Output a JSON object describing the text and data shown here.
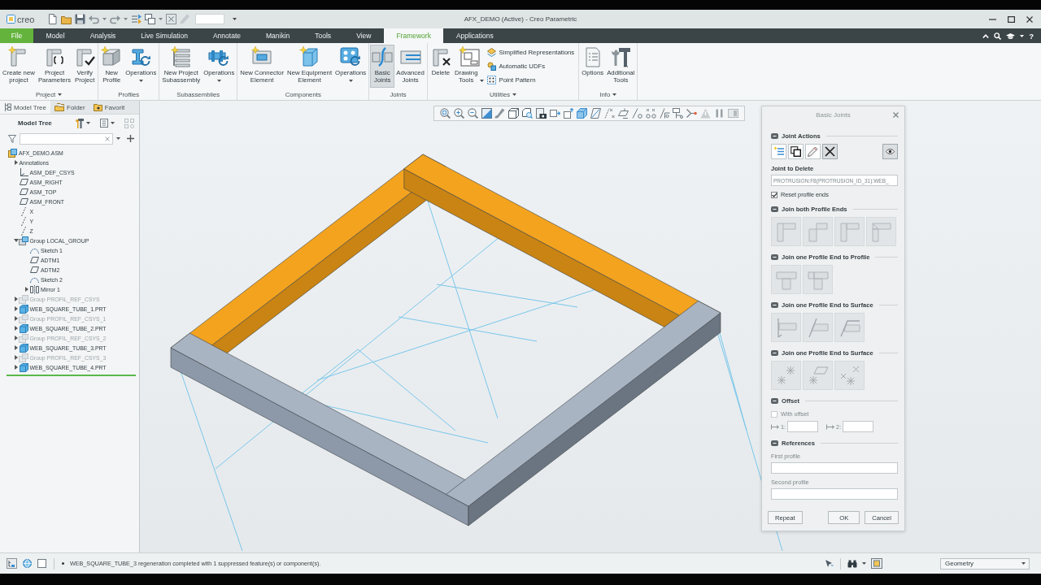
{
  "title_bar": {
    "logo": "creo",
    "title": "AFX_DEMO (Active) - Creo Parametric"
  },
  "tabs": [
    {
      "label": "File",
      "kind": "menu",
      "selected": false
    },
    {
      "label": "Model",
      "kind": "tab",
      "selected": false
    },
    {
      "label": "Analysis",
      "kind": "tab",
      "selected": false
    },
    {
      "label": "Live Simulation",
      "kind": "tab",
      "selected": false
    },
    {
      "label": "Annotate",
      "kind": "tab",
      "selected": false
    },
    {
      "label": "Manikin",
      "kind": "tab",
      "selected": false
    },
    {
      "label": "Tools",
      "kind": "tab",
      "selected": false
    },
    {
      "label": "View",
      "kind": "tab",
      "selected": false
    },
    {
      "label": "Framework",
      "kind": "tab",
      "selected": true
    },
    {
      "label": "Applications",
      "kind": "tab",
      "selected": false
    }
  ],
  "help": "?",
  "ribbon": {
    "groups": [
      {
        "label": "Project",
        "has_menu": true,
        "buttons": [
          {
            "label": "Create new\nproject",
            "has_menu": false,
            "selected": false
          },
          {
            "label": "Project\nParameters",
            "has_menu": false,
            "selected": false
          },
          {
            "label": "Verify\nProject",
            "has_menu": false,
            "selected": false
          }
        ]
      },
      {
        "label": "Profiles",
        "has_menu": false,
        "buttons": [
          {
            "label": "New\nProfile",
            "has_menu": false,
            "selected": false
          },
          {
            "label": "Operations",
            "has_menu": true,
            "selected": false
          }
        ]
      },
      {
        "label": "Subassemblies",
        "has_menu": false,
        "buttons": [
          {
            "label": "New Project\nSubassembly",
            "has_menu": false,
            "selected": false
          },
          {
            "label": "Operations",
            "has_menu": true,
            "selected": false
          }
        ]
      },
      {
        "label": "Components",
        "has_menu": false,
        "buttons": [
          {
            "label": "New Connector\nElement",
            "has_menu": false,
            "selected": false
          },
          {
            "label": "New Equipment\nElement",
            "has_menu": false,
            "selected": false
          },
          {
            "label": "Operations",
            "has_menu": true,
            "selected": false
          }
        ]
      },
      {
        "label": "Joints",
        "has_menu": false,
        "buttons": [
          {
            "label": "Basic\nJoints",
            "has_menu": false,
            "selected": true
          },
          {
            "label": "Advanced\nJoints",
            "has_menu": false,
            "selected": false
          }
        ]
      },
      {
        "label": "Utilities",
        "has_menu": true,
        "buttons": [
          {
            "label": "Delete",
            "has_menu": false,
            "selected": false
          },
          {
            "label": "Drawing\nTools",
            "has_menu": true,
            "selected": false
          }
        ],
        "small_buttons": [
          {
            "label": "Simplified Representations"
          },
          {
            "label": "Automatic UDFs"
          },
          {
            "label": "Point Pattern"
          }
        ]
      },
      {
        "label": "Info",
        "has_menu": true,
        "buttons": [
          {
            "label": "Options",
            "has_menu": false,
            "selected": false
          },
          {
            "label": "Additional\nTools",
            "has_menu": false,
            "selected": false
          }
        ]
      }
    ]
  },
  "model_tree": {
    "tabs": [
      {
        "label": "Model Tree",
        "selected": true
      },
      {
        "label": "Folder",
        "selected": false
      },
      {
        "label": "Favorit",
        "selected": false
      }
    ],
    "title": "Model Tree",
    "items": [
      {
        "label": "AFX_DEMO.ASM",
        "kind": "assembly",
        "suppressed": false,
        "children": [
          {
            "label": "Annotations",
            "kind": "annotations",
            "expanded": false,
            "suppressed": false
          },
          {
            "label": "ASM_DEF_CSYS",
            "kind": "csys",
            "suppressed": false
          },
          {
            "label": "ASM_RIGHT",
            "kind": "plane",
            "suppressed": false
          },
          {
            "label": "ASM_TOP",
            "kind": "plane",
            "suppressed": false
          },
          {
            "label": "ASM_FRONT",
            "kind": "plane",
            "suppressed": false
          },
          {
            "label": "X",
            "kind": "axis",
            "suppressed": false
          },
          {
            "label": "Y",
            "kind": "axis",
            "suppressed": false
          },
          {
            "label": "Z",
            "kind": "axis",
            "suppressed": false
          },
          {
            "label": "Group LOCAL_GROUP",
            "kind": "group",
            "expanded": true,
            "suppressed": false,
            "children": [
              {
                "label": "Sketch 1",
                "kind": "sketch",
                "suppressed": false
              },
              {
                "label": "ADTM1",
                "kind": "plane",
                "suppressed": false
              },
              {
                "label": "ADTM2",
                "kind": "plane",
                "suppressed": false
              },
              {
                "label": "Sketch 2",
                "kind": "sketch",
                "suppressed": false
              },
              {
                "label": "Mirror 1",
                "kind": "mirror",
                "expanded": false,
                "suppressed": false
              }
            ]
          },
          {
            "label": "Group PROFIL_REF_CSYS",
            "kind": "group",
            "expanded": false,
            "suppressed": true
          },
          {
            "label": "WEB_SQUARE_TUBE_1.PRT",
            "kind": "part",
            "expanded": false,
            "suppressed": false
          },
          {
            "label": "Group PROFIL_REF_CSYS_1",
            "kind": "group",
            "expanded": false,
            "suppressed": true
          },
          {
            "label": "WEB_SQUARE_TUBE_2.PRT",
            "kind": "part",
            "expanded": false,
            "suppressed": false
          },
          {
            "label": "Group PROFIL_REF_CSYS_2",
            "kind": "group",
            "expanded": false,
            "suppressed": true
          },
          {
            "label": "WEB_SQUARE_TUBE_3.PRT",
            "kind": "part",
            "expanded": false,
            "suppressed": false
          },
          {
            "label": "Group PROFIL_REF_CSYS_3",
            "kind": "group",
            "expanded": false,
            "suppressed": true
          },
          {
            "label": "WEB_SQUARE_TUBE_4.PRT",
            "kind": "part",
            "expanded": false,
            "suppressed": false
          }
        ]
      }
    ]
  },
  "viewport": {
    "beams": [
      {
        "highlighted": true
      },
      {
        "highlighted": true
      },
      {
        "highlighted": false
      },
      {
        "highlighted": false
      }
    ]
  },
  "dialog": {
    "title": "Basic Joints",
    "sections": [
      {
        "kind": "actions",
        "title": "Joint Actions",
        "expanded": true,
        "actions": [
          {
            "selected": false
          },
          {
            "selected": false
          },
          {
            "selected": false
          },
          {
            "selected": true
          }
        ],
        "preview": {
          "selected": true
        },
        "field_label": "Joint to Delete",
        "field_value": "PROTRUSION:F8(PROTRUSION_ID_31):WEB_",
        "checkbox": {
          "label": "Reset profile ends",
          "checked": true,
          "disabled": false
        }
      },
      {
        "kind": "tiles",
        "title": "Join both Profile Ends",
        "expanded": true,
        "tiles": [
          {
            "disabled": true
          },
          {
            "disabled": true
          },
          {
            "disabled": true
          },
          {
            "disabled": true
          }
        ]
      },
      {
        "kind": "tiles",
        "title": "Join one Profile End to Profile",
        "expanded": true,
        "tiles": [
          {
            "disabled": true
          },
          {
            "disabled": true
          }
        ]
      },
      {
        "kind": "tiles",
        "title": "Join one Profile End to Surface",
        "expanded": true,
        "tiles": [
          {
            "disabled": true
          },
          {
            "disabled": true
          },
          {
            "disabled": true
          }
        ]
      },
      {
        "kind": "tiles",
        "title": "Join one Profile End to Surface",
        "expanded": true,
        "tiles": [
          {
            "disabled": true
          },
          {
            "disabled": true
          },
          {
            "disabled": true
          }
        ]
      },
      {
        "kind": "offset",
        "title": "Offset",
        "expanded": true,
        "checkbox": {
          "label": "With offset",
          "checked": false,
          "disabled": true
        },
        "fields": [
          {
            "label": "1:",
            "disabled": true
          },
          {
            "label": "2:",
            "disabled": true
          }
        ]
      },
      {
        "kind": "references",
        "title": "References",
        "expanded": true,
        "fields": [
          {
            "label": "First profile",
            "disabled": true
          },
          {
            "label": "Second profile",
            "disabled": true
          }
        ]
      }
    ],
    "buttons": [
      {
        "label": "Repeat"
      },
      {
        "label": "OK"
      },
      {
        "label": "Cancel"
      }
    ]
  },
  "status_bar": {
    "message": "WEB_SQUARE_TUBE_3 regeneration completed with 1 suppressed feature(s) or component(s).",
    "filter": "Geometry"
  }
}
